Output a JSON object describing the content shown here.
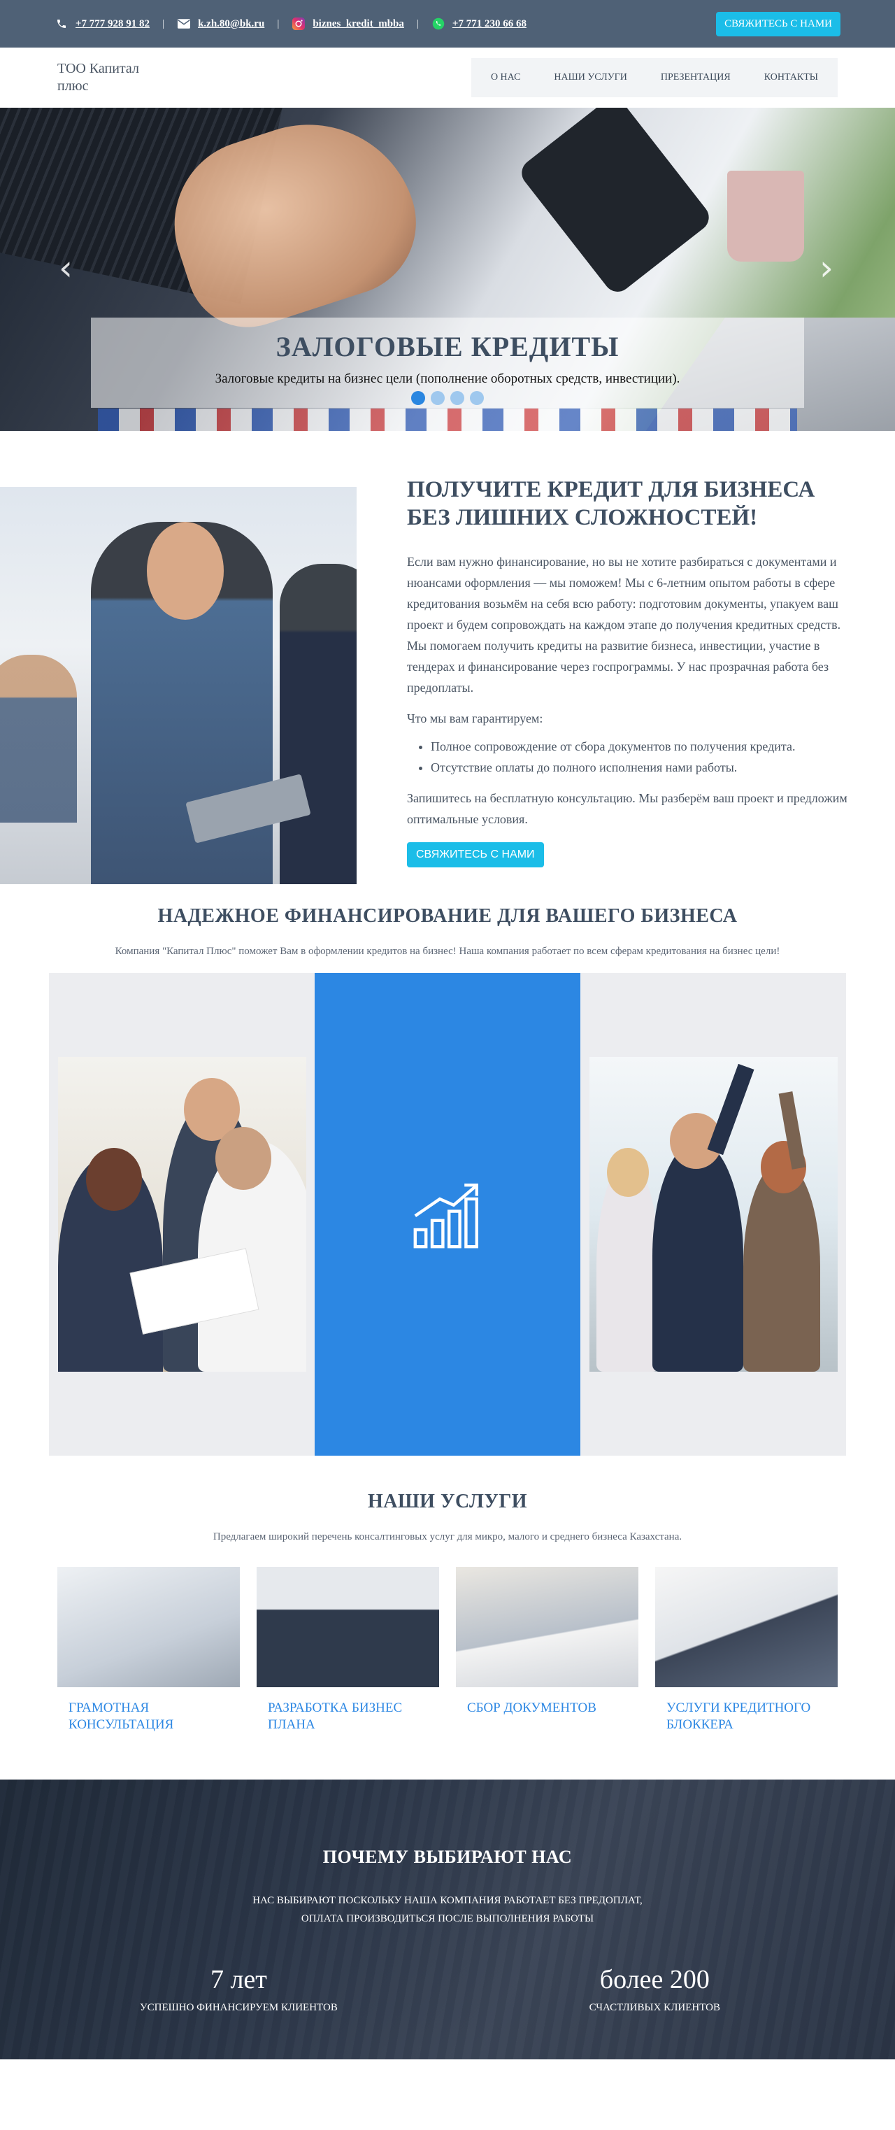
{
  "topbar": {
    "phone1": "+7 777 928 91 82",
    "email": "k.zh.80@bk.ru",
    "instagram": "biznes_kredit_mbba",
    "whatsapp": "+7 771 230 66 68",
    "separator": "|",
    "cta": "Свяжитесь с нами",
    "icons": [
      "phone-icon",
      "mail-icon",
      "instagram-icon",
      "whatsapp-icon"
    ],
    "background": "#4f6176",
    "cta_color": "#1bbde8"
  },
  "nav": {
    "brand": "ТОО Капитал плюс",
    "items": [
      "О нас",
      "Наши услуги",
      "Презентация",
      "Контакты"
    ]
  },
  "hero": {
    "title": "Залоговые кредиты",
    "subtitle": "Залоговые кредиты на бизнес цели (пополнение оборотных средств, инвестиции).",
    "slides_total": 4,
    "active_slide": 1,
    "prev": "‹",
    "next": "›"
  },
  "about": {
    "title": "Получите кредит для бизнеса без лишних сложностей!",
    "paragraph1": "Если вам нужно финансирование, но вы не хотите разбираться с документами и нюансами оформления — мы поможем! Мы с 6-летним опытом работы в сфере кредитования возьмём на себя всю работу: подготовим документы, упакуем ваш проект и будем сопровождать на каждом этапе до получения кредитных средств. Мы помогаем получить кредиты на развитие бизнеса, инвестиции, участие в тендерах и финансирование через госпрограммы. У нас прозрачная работа без предоплаты.",
    "guarantee_intro": "Что мы вам гарантируем:",
    "guarantees": [
      "Полное сопровождение от сбора документов по получения кредита.",
      "Отсутствие оплаты до полного исполнения нами работы."
    ],
    "paragraph2": "Запишитесь на бесплатную консультацию. Мы разберём ваш проект и предложим оптимальные условия.",
    "cta": "Свяжитесь с нами"
  },
  "financing": {
    "title": "Надежное финансирование для вашего бизнеса",
    "subtitle": "Компания \"Капитал Плюс\" поможет Вам в оформлении кредитов на бизнес! Наша компания работает по всем сферам кредитования на бизнес цели!",
    "center_icon": "growth-chart-icon",
    "accent": "#2c87e3"
  },
  "services": {
    "title": "Наши услуги",
    "subtitle": "Предлагаем широкий перечень консалтинговых услуг для микро, малого и среднего бизнеса Казахстана.",
    "items": [
      "Грамотная консультация",
      "Разработка бизнес плана",
      "Сбор документов",
      "Услуги кредитного блоккера"
    ]
  },
  "why": {
    "title": "Почему выбирают нас",
    "line1": "Нас выбирают поскольку наша компания работает без предоплат,",
    "line2": "оплата производиться после выполнения работы",
    "stats": [
      {
        "value": "7 лет",
        "caption": "Успешно финансируем клиентов"
      },
      {
        "value": "более 200",
        "caption": "счастливых клиентов"
      }
    ]
  }
}
